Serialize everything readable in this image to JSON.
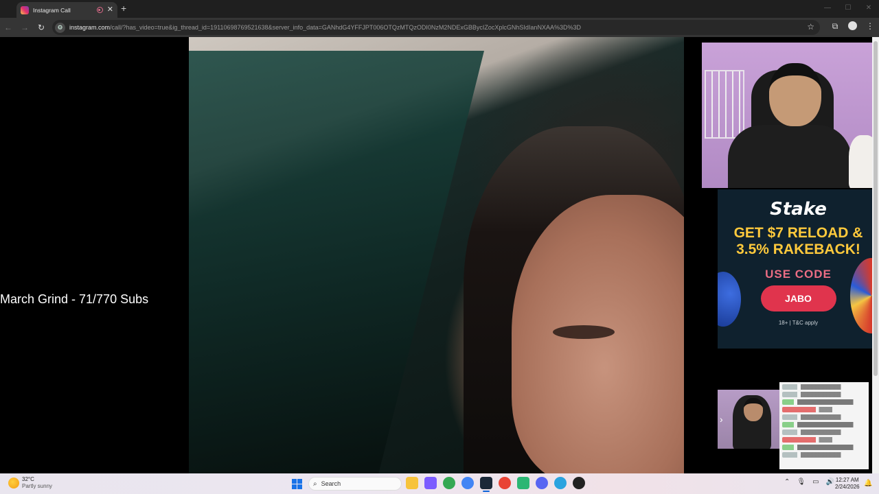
{
  "browser": {
    "tab_title": "Instagram Call",
    "url_host": "instagram.com",
    "url_path": "/call/?has_video=true&ig_thread_id=19110698769521638&server_info_data=GANhdG4YFFJPT006OTQzMTQzODI0NzM2NDExGBBycIZocXplcGNhSIdIanNXAA%3D%3D",
    "window_controls": [
      "—",
      "☐",
      "✕"
    ]
  },
  "stream": {
    "overlay_text": "March Grind - 71/770 Subs"
  },
  "ad": {
    "brand": "Stake",
    "headline_line1": "GET $7 RELOAD &",
    "headline_line2": "3.5% RAKEBACK!",
    "use_code_label": "USE CODE",
    "code": "JABO",
    "disclaimer": "18+ | T&C apply",
    "colors": {
      "background": "#0f212e",
      "headline": "#ffc93c",
      "accent": "#e0344d"
    }
  },
  "taskbar": {
    "temperature": "32°C",
    "weather": "Partly sunny",
    "search_placeholder": "Search",
    "time": "12:27 AM",
    "date": "2/24/2026",
    "apps": [
      "file-explorer",
      "copilot",
      "chrome-profile-1",
      "chrome",
      "steam",
      "chrome-profile-2",
      "terminal",
      "discord",
      "telegram",
      "recorder"
    ],
    "app_colors": [
      "#f7c33b",
      "#7b5cff",
      "#34a853",
      "#4285f4",
      "#1b2838",
      "#e94335",
      "#2bb673",
      "#5865f2",
      "#2aa3df",
      "#222222"
    ]
  }
}
